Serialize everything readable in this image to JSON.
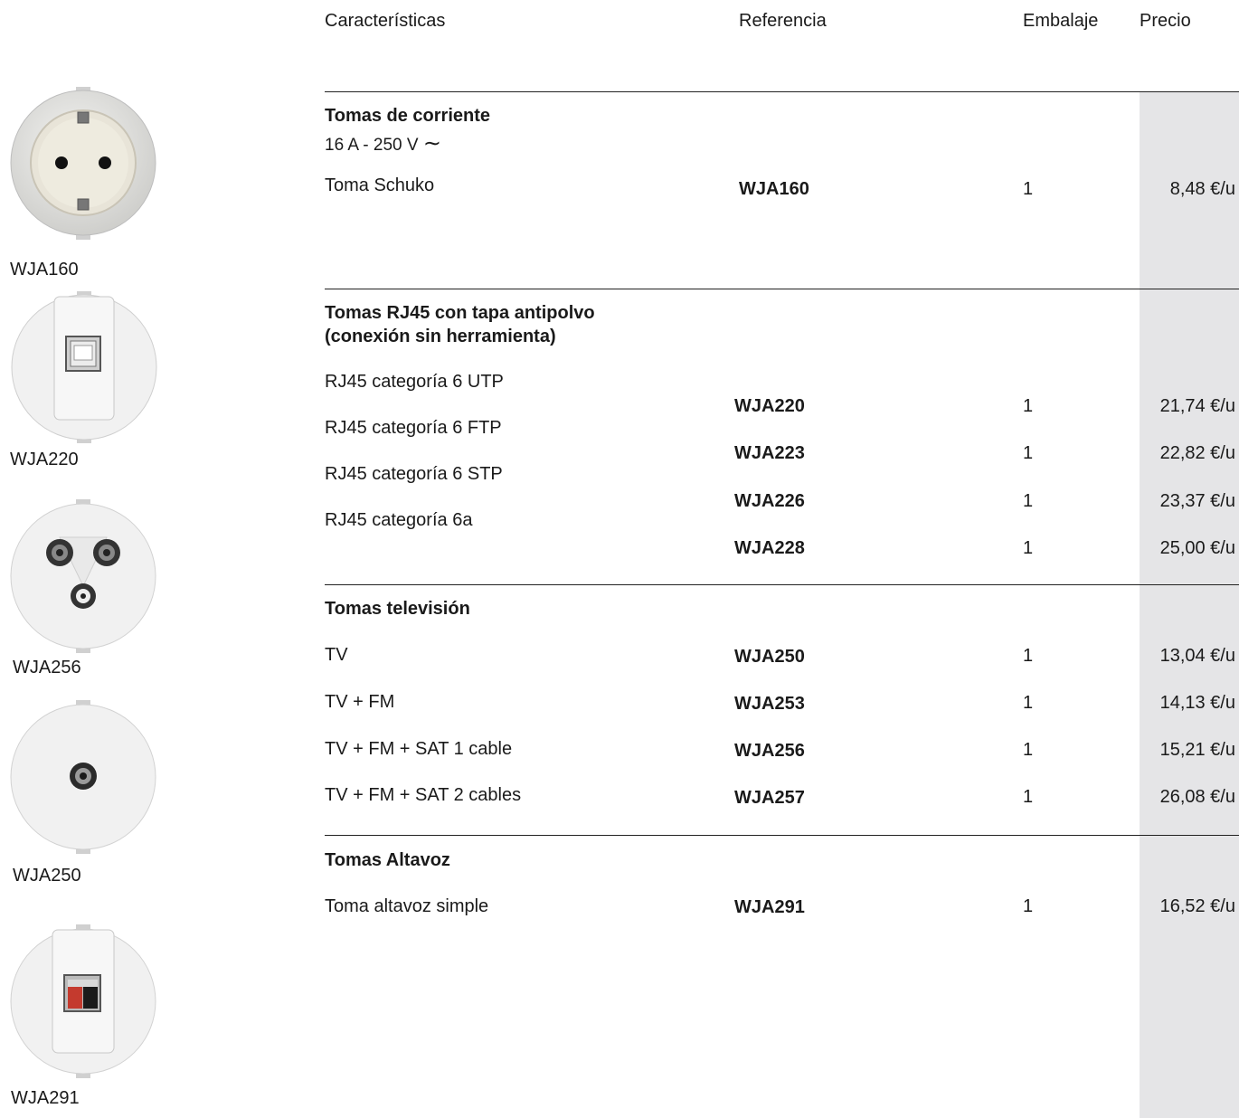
{
  "header": {
    "caracteristicas": "Características",
    "referencia": "Referencia",
    "embalaje": "Embalaje",
    "precio": "Precio"
  },
  "images": [
    {
      "label": "WJA160",
      "icon": "schuko-socket-icon"
    },
    {
      "label": "WJA220",
      "icon": "rj45-socket-icon"
    },
    {
      "label": "WJA256",
      "icon": "tv-fm-sat-socket-icon"
    },
    {
      "label": "WJA250",
      "icon": "tv-socket-icon"
    },
    {
      "label": "WJA291",
      "icon": "speaker-socket-icon"
    }
  ],
  "sections": [
    {
      "title": "Tomas de corriente",
      "subtitle": "16 A - 250 V",
      "subtitle_symbol": "∼",
      "rows": [
        {
          "desc": "Toma Schuko",
          "ref": "WJA160",
          "qty": "1",
          "price": "8,48 €/u"
        }
      ]
    },
    {
      "title_line1": "Tomas RJ45 con tapa antipolvo",
      "title_line2": "(conexión sin herramienta)",
      "rows": [
        {
          "desc": "RJ45 categoría 6 UTP",
          "ref": "WJA220",
          "qty": "1",
          "price": "21,74 €/u"
        },
        {
          "desc": "RJ45 categoría 6 FTP",
          "ref": "WJA223",
          "qty": "1",
          "price": "22,82 €/u"
        },
        {
          "desc": "RJ45 categoría 6 STP",
          "ref": "WJA226",
          "qty": "1",
          "price": "23,37 €/u"
        },
        {
          "desc": "RJ45 categoría 6a",
          "ref": "WJA228",
          "qty": "1",
          "price": "25,00 €/u"
        }
      ]
    },
    {
      "title": "Tomas televisión",
      "rows": [
        {
          "desc": "TV",
          "ref": "WJA250",
          "qty": "1",
          "price": "13,04 €/u"
        },
        {
          "desc": "TV + FM",
          "ref": "WJA253",
          "qty": "1",
          "price": "14,13 €/u"
        },
        {
          "desc": "TV + FM + SAT 1 cable",
          "ref": "WJA256",
          "qty": "1",
          "price": "15,21 €/u"
        },
        {
          "desc": "TV + FM + SAT 2 cables",
          "ref": "WJA257",
          "qty": "1",
          "price": "26,08 €/u"
        }
      ]
    },
    {
      "title": "Tomas Altavoz",
      "rows": [
        {
          "desc": "Toma altavoz  simple",
          "ref": "WJA291",
          "qty": "1",
          "price": "16,52 €/u"
        }
      ]
    }
  ],
  "colors": {
    "price_column_bg": "#e5e5e7",
    "rule": "#222222",
    "socket_white": "#f2f2f2"
  }
}
